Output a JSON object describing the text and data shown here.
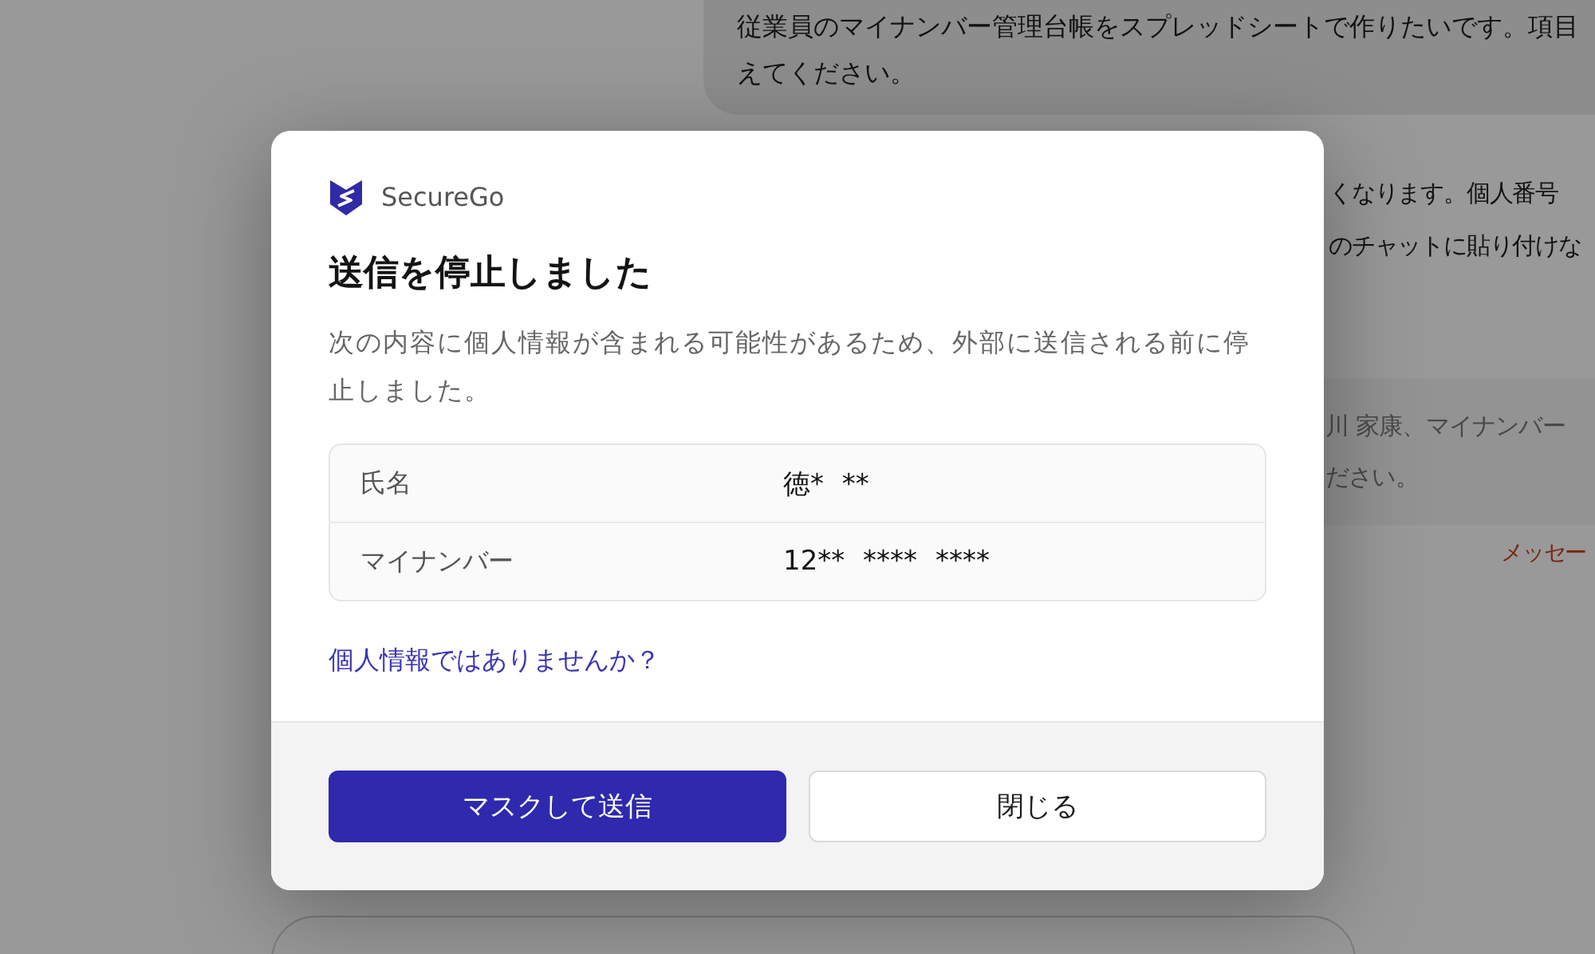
{
  "background_chat": {
    "user_message_lines": [
      "従業員のマイナンバー管理台帳をスプレッドシートで作りたいです。項目",
      "えてください。"
    ],
    "assistant_lines": [
      "くなります。個人番号",
      "のチャットに貼り付けな"
    ],
    "quoted_lines": [
      "川 家康、マイナンバー",
      "ださい。"
    ],
    "notice": "メッセー"
  },
  "dialog": {
    "brand": "SecureGo",
    "title": "送信を停止しました",
    "message": "次の内容に個人情報が含まれる可能性があるため、外部に送信される前に停止しました。",
    "detected": [
      {
        "label": "氏名",
        "value": "徳* **"
      },
      {
        "label": "マイナンバー",
        "value": "12** **** ****"
      }
    ],
    "link": "個人情報ではありませんか？",
    "buttons": [
      {
        "label": "マスクして送信",
        "kind": "primary"
      },
      {
        "label": "閉じる",
        "kind": "secondary"
      }
    ]
  }
}
